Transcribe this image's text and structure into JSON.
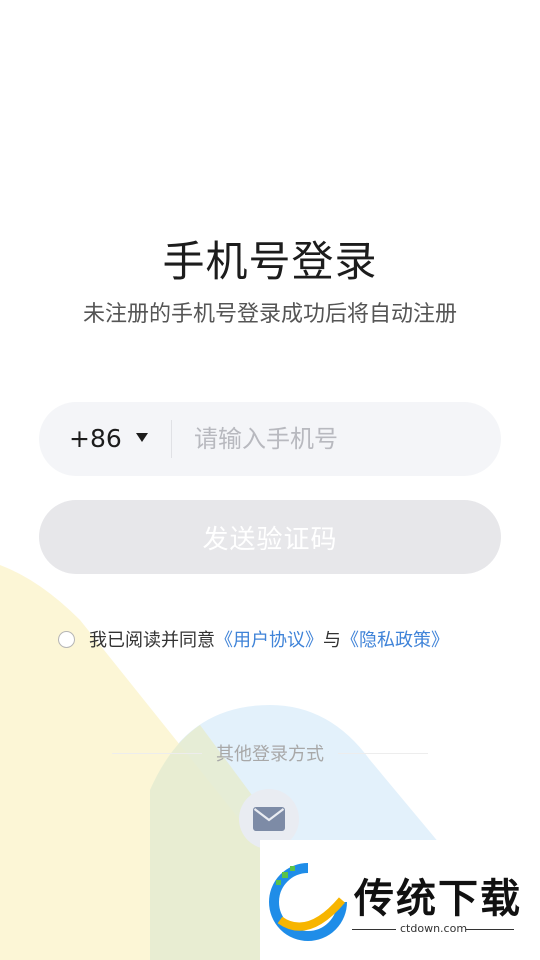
{
  "login": {
    "title": "手机号登录",
    "subtitle": "未注册的手机号登录成功后将自动注册",
    "country_code": "+86",
    "phone_placeholder": "请输入手机号",
    "send_code_label": "发送验证码"
  },
  "agreement": {
    "prefix": "我已阅读并同意",
    "user_agreement": "《用户协议》",
    "conjunction": "与",
    "privacy_policy": "《隐私政策》"
  },
  "other_login": {
    "label": "其他登录方式",
    "methods": [
      "mail-icon"
    ]
  },
  "watermark": {
    "brand": "传统下载",
    "url": "ctdown.com"
  },
  "colors": {
    "link": "#3f83d8",
    "input_bg": "#f4f5f8",
    "button_disabled_bg": "#e7e7ea",
    "yellow_shape": "#fcf6d4",
    "blue_shape": "#e3f1fb"
  }
}
